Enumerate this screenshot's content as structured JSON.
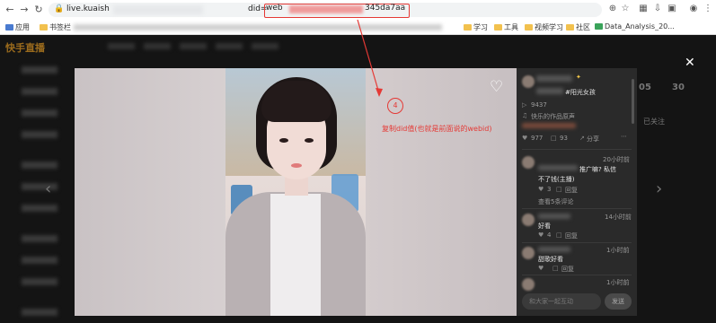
{
  "browser": {
    "url_prefix": "live.kuaish",
    "url_param_label": "did=",
    "url_highlight_start": "web",
    "url_highlight_end": "345da7aa",
    "bookmarks": [
      {
        "label": "应用",
        "folder": false
      },
      {
        "label": "书签栏",
        "folder": true
      },
      {
        "label": "学习",
        "folder": true
      },
      {
        "label": "工具",
        "folder": true
      },
      {
        "label": "视频学习",
        "folder": true
      },
      {
        "label": "社区",
        "folder": true
      },
      {
        "label": "Data_Analysis_20...",
        "folder": false
      }
    ]
  },
  "site": {
    "logo": "快手直播",
    "bg_stats": [
      "05",
      "30"
    ],
    "bg_label": "已关注"
  },
  "modal": {
    "close_icon": "close-icon",
    "like_icon": "heart-icon",
    "post_tag": "#阳光女孩",
    "play_count": "9437",
    "music_label": "快乐的作品原声",
    "likes": "977",
    "comments": "93",
    "share": "分享",
    "comment_list": [
      {
        "time": "20小时前",
        "text": "推广嘛? 私信",
        "text2": "不了钱(主播)",
        "likes": "3",
        "reply": "回复",
        "more": "查看5条评论"
      },
      {
        "time": "14小时前",
        "text": "好看",
        "likes": "4",
        "reply": "回复"
      },
      {
        "time": "1小时前",
        "text": "甜歌好看",
        "likes": "",
        "reply": "回复"
      },
      {
        "time": "1小时前",
        "text": "",
        "likes": "",
        "reply": ""
      }
    ],
    "reply_placeholder": "和大家一起互动",
    "send_label": "发送"
  },
  "annotation": {
    "step_number": "4",
    "note": "复制did值(也就是前面说的webid)",
    "color": "#e53935"
  }
}
